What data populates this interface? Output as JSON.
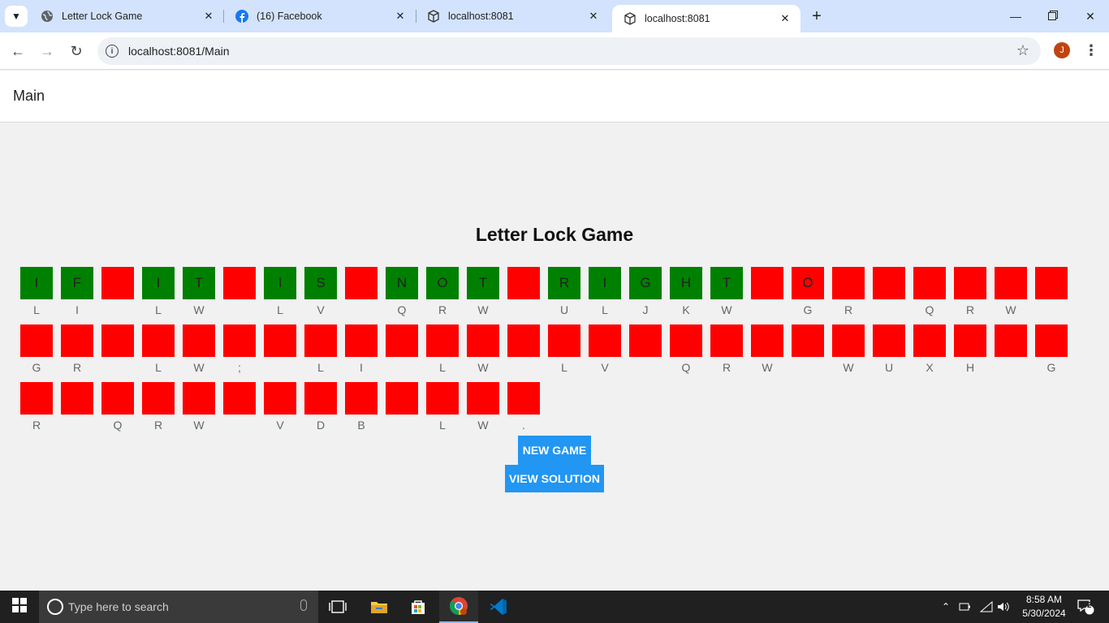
{
  "browser": {
    "tabs": [
      {
        "title": "Letter Lock Game",
        "icon": "globe-icon"
      },
      {
        "title": "(16) Facebook",
        "icon": "facebook-icon"
      },
      {
        "title": "localhost:8081",
        "icon": "cube-icon"
      },
      {
        "title": "localhost:8081",
        "icon": "cube-icon"
      }
    ],
    "active_tab": 3,
    "url": "localhost:8081/Main",
    "avatar_letter": "J"
  },
  "app": {
    "page_title": "Main",
    "game_title": "Letter Lock Game",
    "rows": [
      [
        {
          "letter": "I",
          "color": "green",
          "hint": "L"
        },
        {
          "letter": "F",
          "color": "green",
          "hint": "I"
        },
        {
          "letter": "",
          "color": "red",
          "hint": ""
        },
        {
          "letter": "I",
          "color": "green",
          "hint": "L"
        },
        {
          "letter": "T",
          "color": "green",
          "hint": "W"
        },
        {
          "letter": "",
          "color": "red",
          "hint": ""
        },
        {
          "letter": "I",
          "color": "green",
          "hint": "L"
        },
        {
          "letter": "S",
          "color": "green",
          "hint": "V"
        },
        {
          "letter": "",
          "color": "red",
          "hint": ""
        },
        {
          "letter": "N",
          "color": "green",
          "hint": "Q"
        },
        {
          "letter": "O",
          "color": "green",
          "hint": "R"
        },
        {
          "letter": "T",
          "color": "green",
          "hint": "W"
        },
        {
          "letter": "",
          "color": "red",
          "hint": ""
        },
        {
          "letter": "R",
          "color": "green",
          "hint": "U"
        },
        {
          "letter": "I",
          "color": "green",
          "hint": "L"
        },
        {
          "letter": "G",
          "color": "green",
          "hint": "J"
        },
        {
          "letter": "H",
          "color": "green",
          "hint": "K"
        },
        {
          "letter": "T",
          "color": "green",
          "hint": "W"
        },
        {
          "letter": "",
          "color": "red",
          "hint": ""
        },
        {
          "letter": "O",
          "color": "red",
          "hint": "G"
        },
        {
          "letter": "",
          "color": "red",
          "hint": "R"
        },
        {
          "letter": "",
          "color": "red",
          "hint": ""
        },
        {
          "letter": "",
          "color": "red",
          "hint": "Q"
        },
        {
          "letter": "",
          "color": "red",
          "hint": "R"
        },
        {
          "letter": "",
          "color": "red",
          "hint": "W"
        },
        {
          "letter": "",
          "color": "red",
          "hint": ""
        }
      ],
      [
        {
          "letter": "",
          "color": "red",
          "hint": "G"
        },
        {
          "letter": "",
          "color": "red",
          "hint": "R"
        },
        {
          "letter": "",
          "color": "red",
          "hint": ""
        },
        {
          "letter": "",
          "color": "red",
          "hint": "L"
        },
        {
          "letter": "",
          "color": "red",
          "hint": "W"
        },
        {
          "letter": "",
          "color": "red",
          "hint": ";"
        },
        {
          "letter": "",
          "color": "red",
          "hint": ""
        },
        {
          "letter": "",
          "color": "red",
          "hint": "L"
        },
        {
          "letter": "",
          "color": "red",
          "hint": "I"
        },
        {
          "letter": "",
          "color": "red",
          "hint": ""
        },
        {
          "letter": "",
          "color": "red",
          "hint": "L"
        },
        {
          "letter": "",
          "color": "red",
          "hint": "W"
        },
        {
          "letter": "",
          "color": "red",
          "hint": ""
        },
        {
          "letter": "",
          "color": "red",
          "hint": "L"
        },
        {
          "letter": "",
          "color": "red",
          "hint": "V"
        },
        {
          "letter": "",
          "color": "red",
          "hint": ""
        },
        {
          "letter": "",
          "color": "red",
          "hint": "Q"
        },
        {
          "letter": "",
          "color": "red",
          "hint": "R"
        },
        {
          "letter": "",
          "color": "red",
          "hint": "W"
        },
        {
          "letter": "",
          "color": "red",
          "hint": ""
        },
        {
          "letter": "",
          "color": "red",
          "hint": "W"
        },
        {
          "letter": "",
          "color": "red",
          "hint": "U"
        },
        {
          "letter": "",
          "color": "red",
          "hint": "X"
        },
        {
          "letter": "",
          "color": "red",
          "hint": "H"
        },
        {
          "letter": "",
          "color": "red",
          "hint": ""
        },
        {
          "letter": "",
          "color": "red",
          "hint": "G"
        }
      ],
      [
        {
          "letter": "",
          "color": "red",
          "hint": "R"
        },
        {
          "letter": "",
          "color": "red",
          "hint": ""
        },
        {
          "letter": "",
          "color": "red",
          "hint": "Q"
        },
        {
          "letter": "",
          "color": "red",
          "hint": "R"
        },
        {
          "letter": "",
          "color": "red",
          "hint": "W"
        },
        {
          "letter": "",
          "color": "red",
          "hint": ""
        },
        {
          "letter": "",
          "color": "red",
          "hint": "V"
        },
        {
          "letter": "",
          "color": "red",
          "hint": "D"
        },
        {
          "letter": "",
          "color": "red",
          "hint": "B"
        },
        {
          "letter": "",
          "color": "red",
          "hint": ""
        },
        {
          "letter": "",
          "color": "red",
          "hint": "L"
        },
        {
          "letter": "",
          "color": "red",
          "hint": "W"
        },
        {
          "letter": "",
          "color": "red",
          "hint": "."
        }
      ]
    ],
    "buttons": {
      "new_game": "NEW GAME",
      "view_solution": "VIEW SOLUTION"
    },
    "colors": {
      "correct": "#008000",
      "wrong": "#ff0000",
      "button": "#2196f3"
    }
  },
  "taskbar": {
    "search_placeholder": "Type here to search",
    "time": "8:58 AM",
    "date": "5/30/2024",
    "notification_count": "2",
    "pinned": [
      "task-view-icon",
      "file-explorer-icon",
      "store-icon",
      "chrome-icon",
      "vscode-icon"
    ]
  }
}
